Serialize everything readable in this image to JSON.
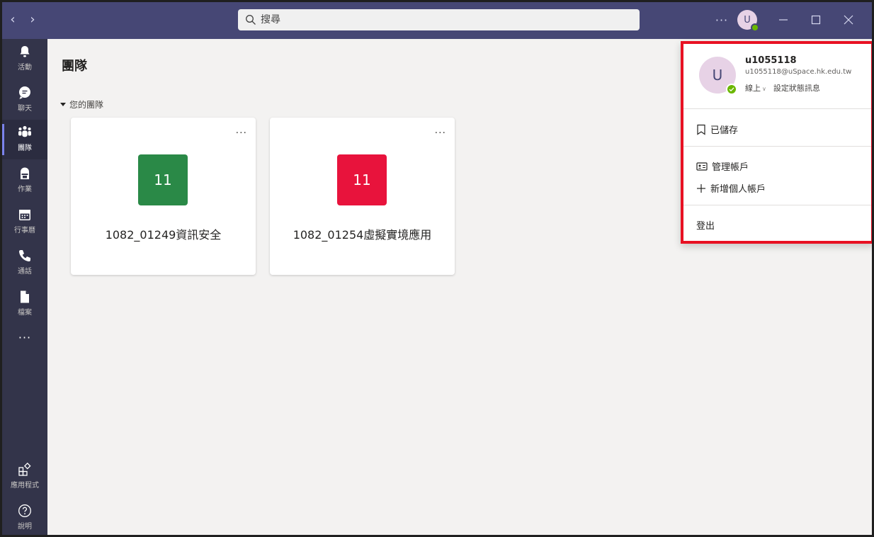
{
  "titlebar": {
    "search_placeholder": "搜尋",
    "more": "···",
    "avatar_initial": "U"
  },
  "rail": {
    "items": [
      {
        "label": "活動",
        "icon": "bell-icon"
      },
      {
        "label": "聊天",
        "icon": "chat-icon"
      },
      {
        "label": "團隊",
        "icon": "teams-icon"
      },
      {
        "label": "作業",
        "icon": "backpack-icon"
      },
      {
        "label": "行事曆",
        "icon": "calendar-icon"
      },
      {
        "label": "通話",
        "icon": "phone-icon"
      },
      {
        "label": "檔案",
        "icon": "file-icon"
      }
    ],
    "more": "···",
    "bottom": [
      {
        "label": "應用程式",
        "icon": "apps-icon"
      },
      {
        "label": "說明",
        "icon": "help-icon"
      }
    ]
  },
  "main": {
    "title": "團隊",
    "section_label": "您的團隊",
    "cards": [
      {
        "tile_text": "11",
        "tile_color": "#2a8947",
        "name": "1082_01249資訊安全",
        "more": "···"
      },
      {
        "tile_text": "11",
        "tile_color": "#e8133c",
        "name": "1082_01254虛擬實境應用",
        "more": "···"
      }
    ]
  },
  "profile": {
    "initial": "U",
    "username": "u1055118",
    "email": "u1055118@uSpace.hk.edu.tw",
    "status": "線上",
    "set_status_message": "設定狀態訊息",
    "saved": "已儲存",
    "manage_account": "管理帳戶",
    "add_personal_account": "新增個人帳戶",
    "sign_out": "登出"
  }
}
